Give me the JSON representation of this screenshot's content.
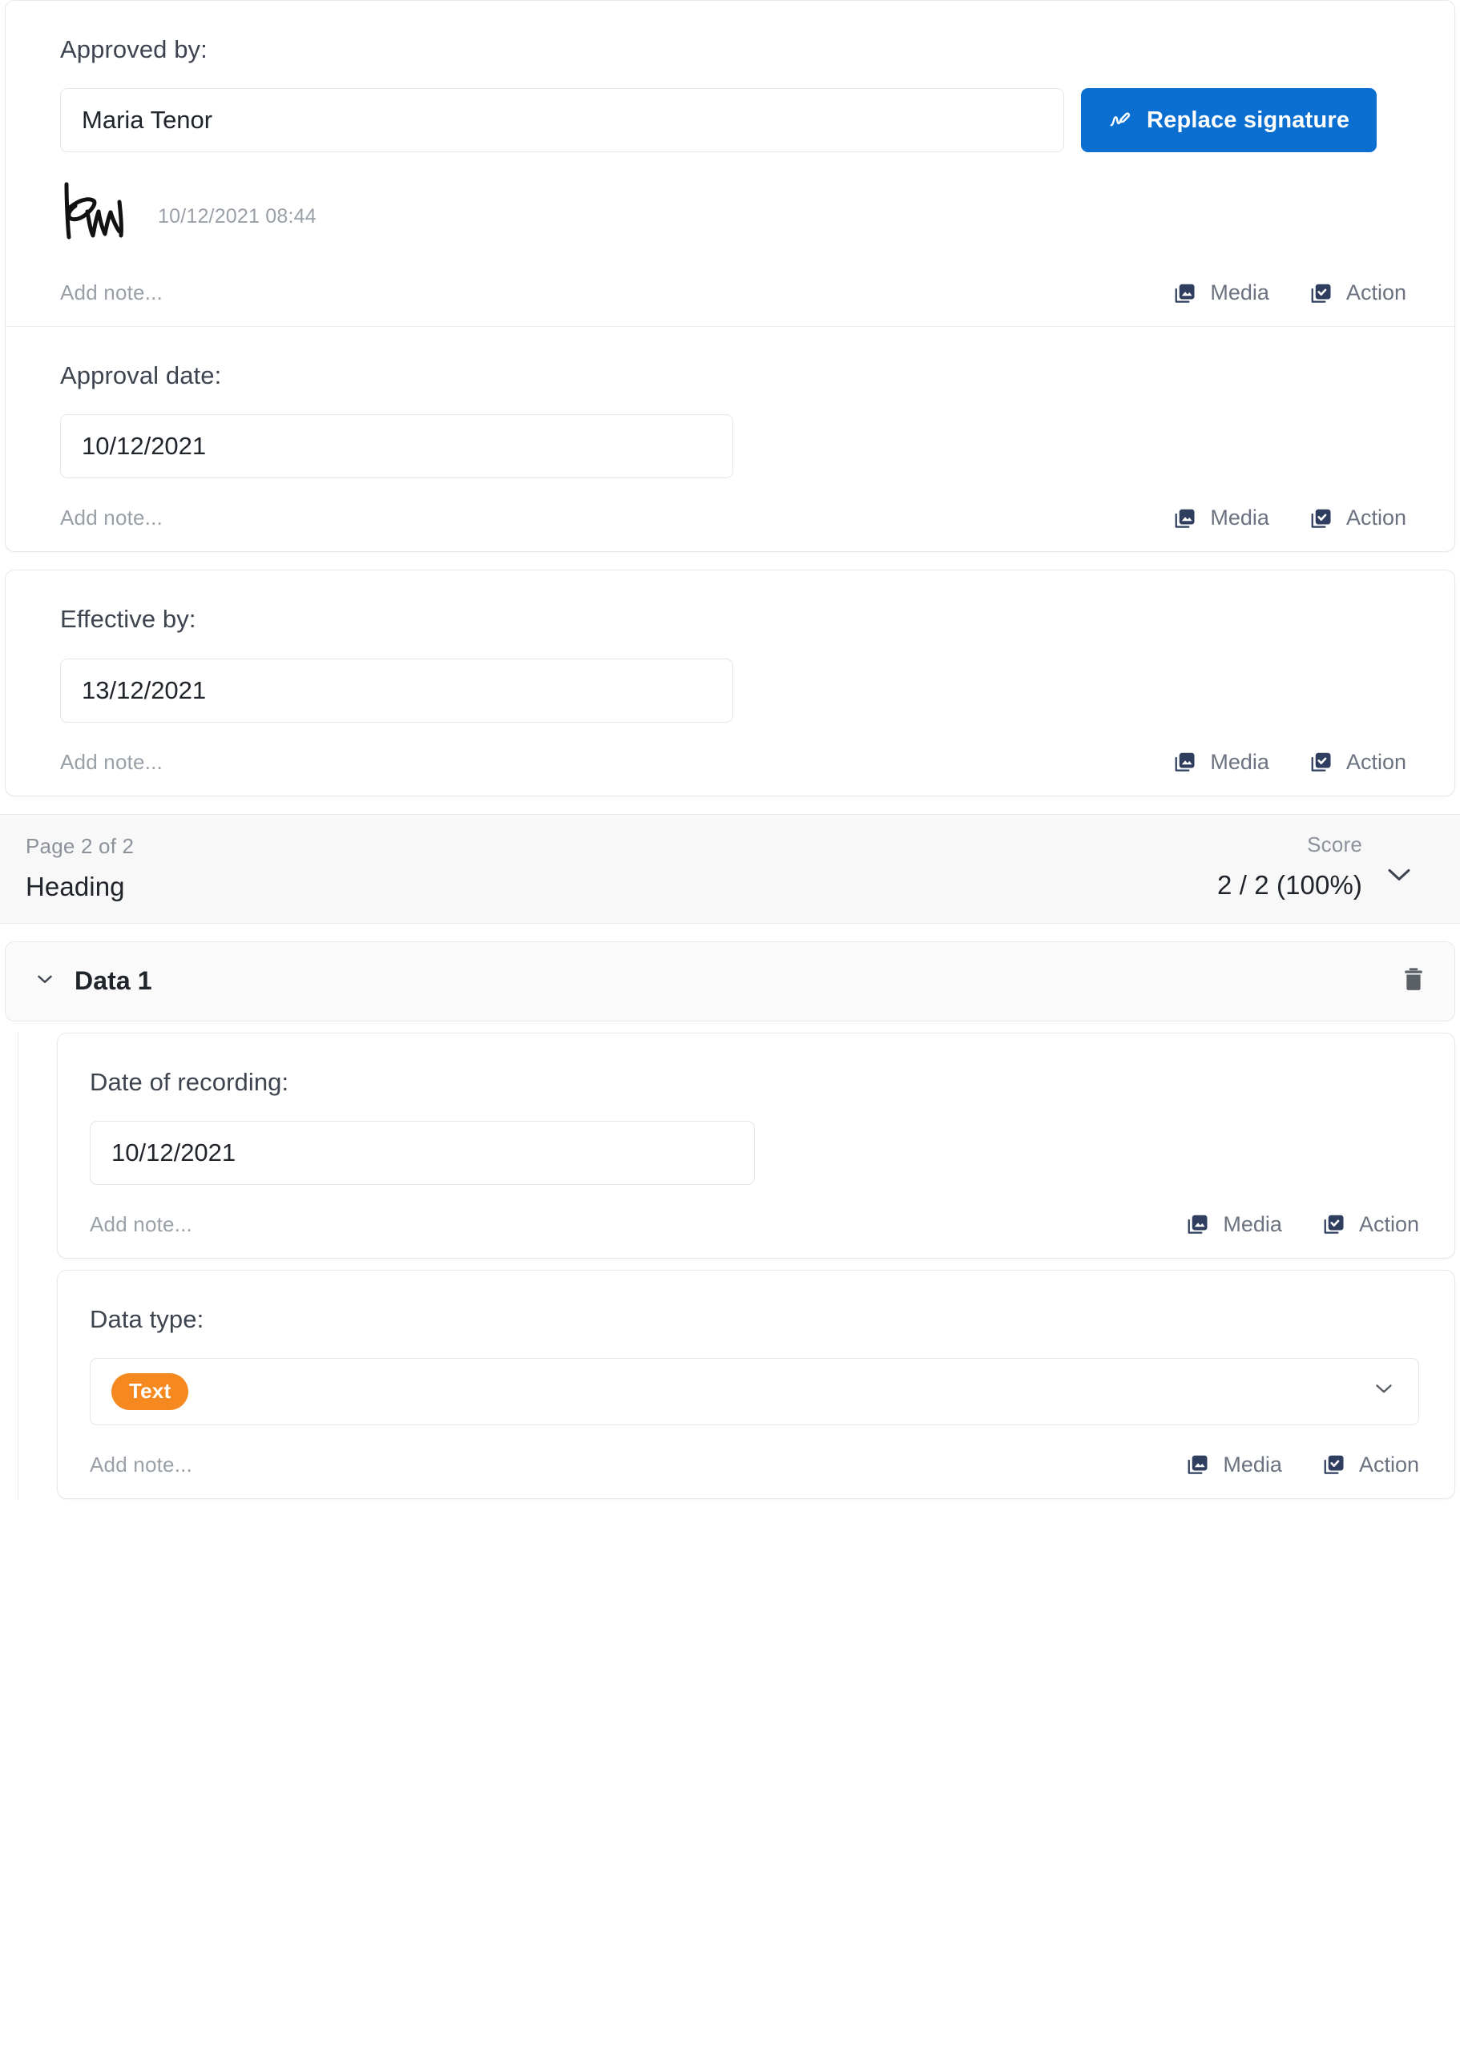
{
  "approved_by": {
    "label": "Approved by:",
    "value": "Maria Tenor",
    "replace_signature_label": "Replace signature",
    "signature_timestamp": "10/12/2021 08:44",
    "note_placeholder": "Add note...",
    "media_label": "Media",
    "action_label": "Action"
  },
  "approval_date": {
    "label": "Approval date:",
    "value": "10/12/2021",
    "note_placeholder": "Add note...",
    "media_label": "Media",
    "action_label": "Action"
  },
  "effective_by": {
    "label": "Effective by:",
    "value": "13/12/2021",
    "note_placeholder": "Add note...",
    "media_label": "Media",
    "action_label": "Action"
  },
  "page_bar": {
    "page_indicator": "Page 2 of 2",
    "heading": "Heading",
    "score_label": "Score",
    "score_value": "2 / 2 (100%)"
  },
  "group": {
    "title": "Data 1"
  },
  "date_of_recording": {
    "label": "Date of recording:",
    "value": "10/12/2021",
    "note_placeholder": "Add note...",
    "media_label": "Media",
    "action_label": "Action"
  },
  "data_type": {
    "label": "Data type:",
    "value": "Text",
    "note_placeholder": "Add note...",
    "media_label": "Media",
    "action_label": "Action"
  },
  "colors": {
    "primary_blue": "#0a6fd0",
    "chip_orange": "#f5881f",
    "icon_navy": "#2f3e5e",
    "muted_text": "#9aa0a8",
    "body_text": "#20242b"
  },
  "icons": {
    "signature": "signature-pen-icon",
    "media": "media-image-icon",
    "action": "action-checkbox-icon",
    "chevron_down": "chevron-down-icon",
    "trash": "trash-icon"
  }
}
